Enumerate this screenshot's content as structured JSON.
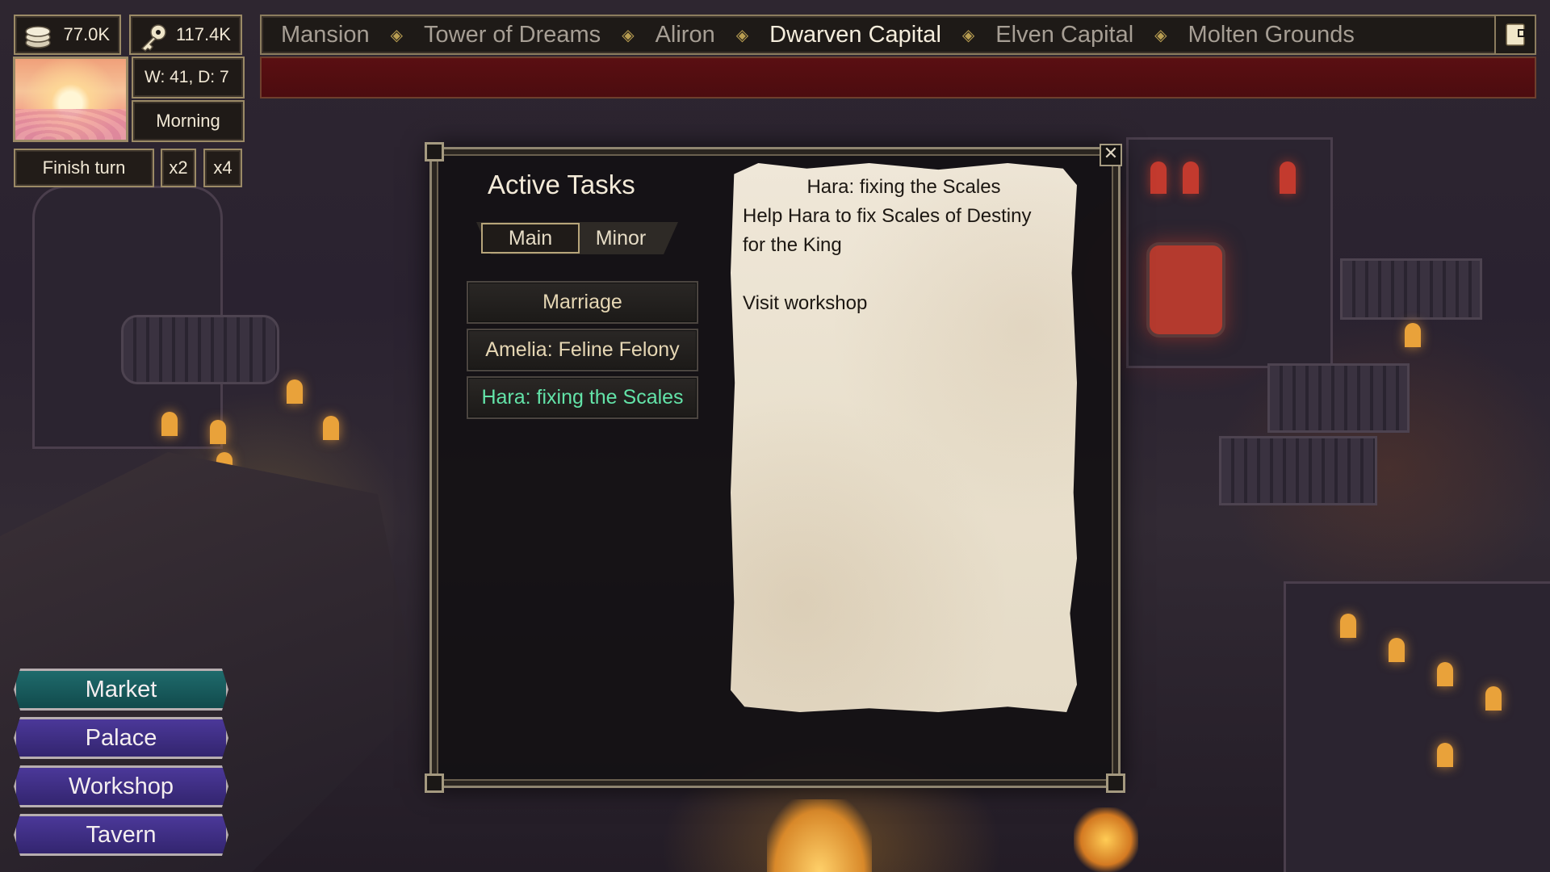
{
  "resources": {
    "gold": "77.0K",
    "keys": "117.4K"
  },
  "time": {
    "week_day": "W: 41, D: 7",
    "period": "Morning"
  },
  "turn_controls": {
    "finish": "Finish turn",
    "x2": "x2",
    "x4": "x4"
  },
  "nav": {
    "items": [
      {
        "label": "Mansion"
      },
      {
        "label": "Tower of Dreams"
      },
      {
        "label": "Aliron"
      },
      {
        "label": "Dwarven Capital",
        "active": true
      },
      {
        "label": "Elven Capital"
      },
      {
        "label": "Molten Grounds"
      }
    ],
    "separator": "◈"
  },
  "locations": [
    {
      "label": "Market",
      "color": "teal"
    },
    {
      "label": "Palace",
      "color": "purple"
    },
    {
      "label": "Workshop",
      "color": "purple"
    },
    {
      "label": "Tavern",
      "color": "purple"
    }
  ],
  "dialog": {
    "title": "Active Tasks",
    "tabs": {
      "main": "Main",
      "minor": "Minor",
      "active": "Main"
    },
    "tasks": [
      {
        "label": "Marriage"
      },
      {
        "label": "Amelia: Feline Felony"
      },
      {
        "label": "Hara: fixing the Scales",
        "selected": true
      }
    ],
    "close": "✕",
    "detail": {
      "title": "Hara: fixing the Scales",
      "line1": "Help Hara to fix Scales of Destiny",
      "line2": "for the King",
      "objective": "Visit workshop"
    }
  },
  "colors": {
    "selected_task": "#63e3a8",
    "banner": "#5a0f12",
    "market_btn": "#1f6b6c",
    "location_btn": "#4b3899"
  }
}
